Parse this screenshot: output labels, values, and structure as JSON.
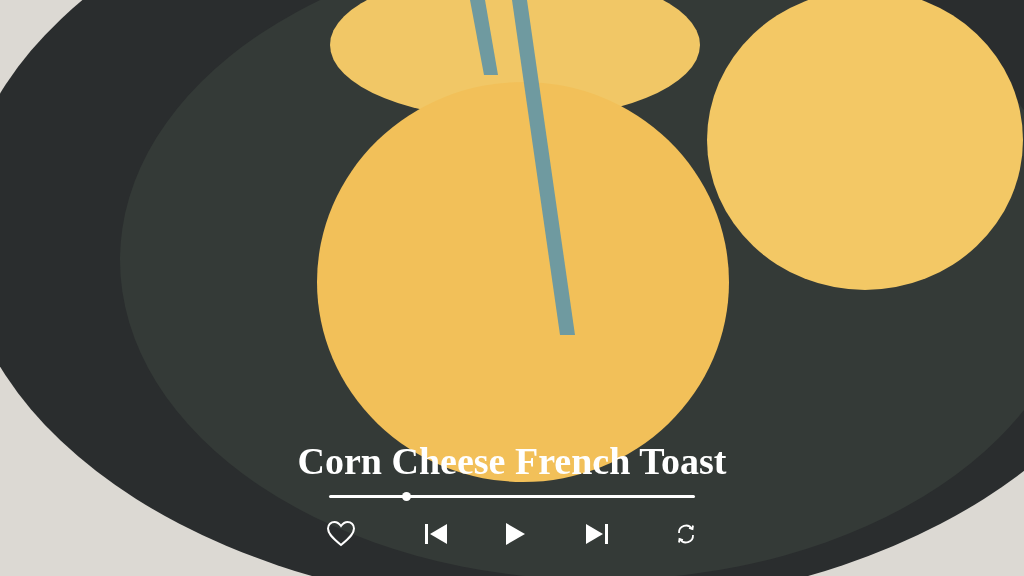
{
  "video_title": "Corn Cheese French Toast",
  "progress": {
    "level": 0.21
  }
}
